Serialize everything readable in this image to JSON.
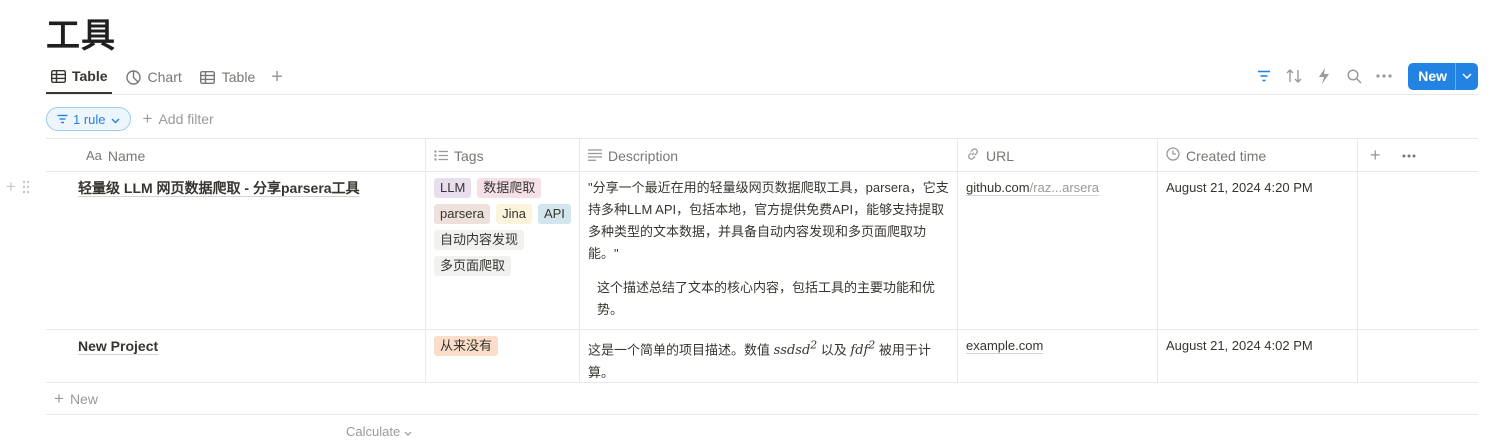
{
  "page": {
    "title": "工具"
  },
  "views": [
    {
      "label": "Table",
      "icon": "table-icon",
      "active": true
    },
    {
      "label": "Chart",
      "icon": "chart-icon",
      "active": false
    },
    {
      "label": "Table",
      "icon": "table-icon",
      "active": false
    }
  ],
  "toolbar": {
    "new_label": "New"
  },
  "filter": {
    "rule_label": "1 rule",
    "add_filter_label": "Add filter"
  },
  "columns": {
    "name": "Name",
    "tags": "Tags",
    "description": "Description",
    "url": "URL",
    "created": "Created time"
  },
  "rows": [
    {
      "name": "轻量级 LLM 网页数据爬取 - 分享parsera工具",
      "tags": [
        {
          "label": "LLM",
          "color": "#e8deee"
        },
        {
          "label": "数据爬取",
          "color": "#f5e0e9"
        },
        {
          "label": "parsera",
          "color": "#eee0da"
        },
        {
          "label": "Jina",
          "color": "#fbf3db"
        },
        {
          "label": "API",
          "color": "#d3e5ef"
        },
        {
          "label": "自动内容发现",
          "color": "#f1f1ef"
        },
        {
          "label": "多页面爬取",
          "color": "#f1f1ef"
        }
      ],
      "description_1": "\"分享一个最近在用的轻量级网页数据爬取工具，parsera，它支持多种LLM API，包括本地，官方提供免费API，能够支持提取多种类型的文本数据，并具备自动内容发现和多页面爬取功能。\"",
      "description_2": "这个描述总结了文本的核心内容，包括工具的主要功能和优势。",
      "url_start": "github.com",
      "url_rest": "/raz...arsera",
      "created": "August 21, 2024 4:20 PM"
    },
    {
      "name": "New Project",
      "tags": [
        {
          "label": "从来没有",
          "color": "#fadec9"
        }
      ],
      "description_a": "这是一个简单的项目描述。数值 ",
      "math_1_base": "ssdsd",
      "math_1_exp": "2",
      "description_b": " 以及 ",
      "math_2_base": "fdf",
      "math_2_exp": "2",
      "description_c": " 被用于计算。",
      "url": "example.com",
      "created": "August 21, 2024 4:02 PM"
    }
  ],
  "footer": {
    "new_label": "New",
    "calculate_label": "Calculate"
  }
}
